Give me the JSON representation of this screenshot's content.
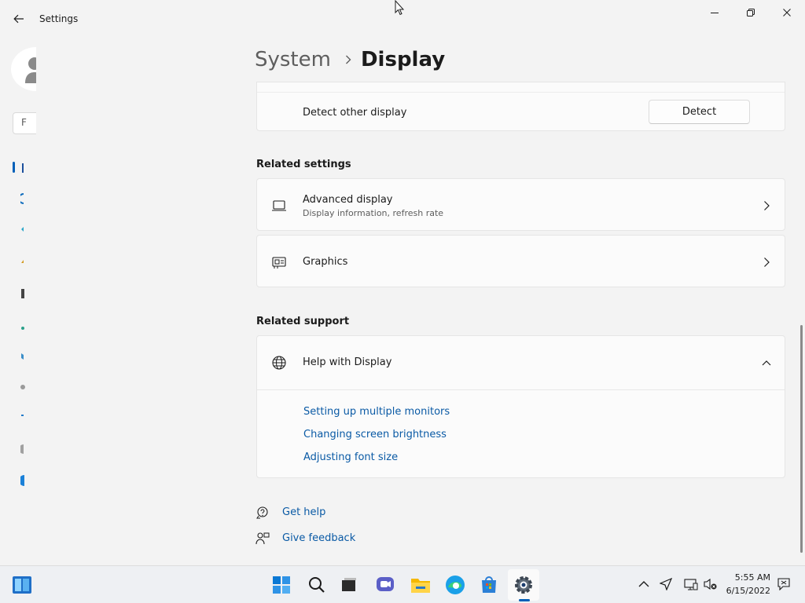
{
  "window": {
    "app_title": "Settings",
    "back_icon": "arrow-left-icon",
    "minimize_icon": "minimize-icon",
    "maximize_icon": "restore-icon",
    "close_icon": "close-icon"
  },
  "nav": {
    "search_text": "F",
    "items": [
      "system-icon",
      "bluetooth-icon",
      "network-icon",
      "personalization-icon",
      "apps-icon",
      "accounts-icon",
      "time-language-icon",
      "gaming-icon",
      "accessibility-icon",
      "privacy-icon",
      "update-icon"
    ]
  },
  "breadcrumb": {
    "parent": "System",
    "current": "Display"
  },
  "detect": {
    "label": "Detect other display",
    "button": "Detect"
  },
  "related_settings": {
    "title": "Related settings",
    "items": [
      {
        "title": "Advanced display",
        "subtitle": "Display information, refresh rate",
        "icon": "laptop-icon"
      },
      {
        "title": "Graphics",
        "subtitle": "",
        "icon": "graphics-card-icon"
      }
    ]
  },
  "related_support": {
    "title": "Related support",
    "help": {
      "title": "Help with Display",
      "icon": "globe-icon",
      "links": [
        "Setting up multiple monitors",
        "Changing screen brightness",
        "Adjusting font size"
      ]
    }
  },
  "footer": {
    "get_help": "Get help",
    "give_feedback": "Give feedback"
  },
  "taskbar": {
    "apps": [
      "widgets-icon",
      "start-icon",
      "search-icon",
      "task-view-icon",
      "chat-icon",
      "file-explorer-icon",
      "edge-icon",
      "store-icon",
      "settings-icon"
    ],
    "time": "5:55 AM",
    "date": "6/15/2022"
  },
  "colors": {
    "accent": "#005fb8",
    "link": "#0a5aa5",
    "background": "#f3f3f3",
    "card": "#fbfbfb"
  }
}
